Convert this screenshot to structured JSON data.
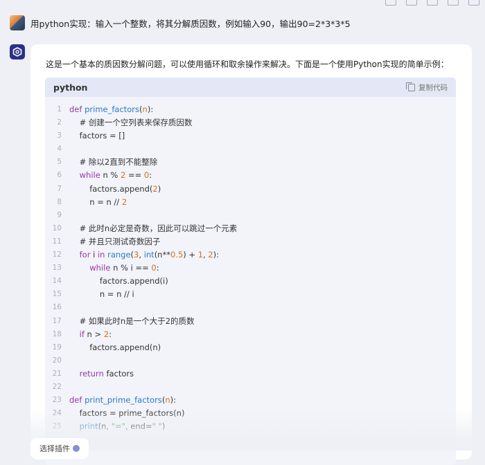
{
  "user": {
    "message": "用python实现：输入一个整数，将其分解质因数，例如输入90，输出90=2*3*3*5"
  },
  "answer": {
    "intro": "这是一个基本的质因数分解问题，可以使用循环和取余操作来解决。下面是一个使用Python实现的简单示例：",
    "code_block": {
      "language": "python",
      "copy_label": "复制代码",
      "lines": [
        [
          {
            "t": "def ",
            "c": "kw"
          },
          {
            "t": "prime_factors",
            "c": "fn"
          },
          {
            "t": "(",
            "c": ""
          },
          {
            "t": "n",
            "c": "num"
          },
          {
            "t": "):",
            "c": ""
          }
        ],
        [
          {
            "t": "    # 创建一个空列表来保存质因数",
            "c": "cm"
          }
        ],
        [
          {
            "t": "    factors = []",
            "c": ""
          }
        ],
        [],
        [
          {
            "t": "    # 除以2直到不能整除",
            "c": "cm"
          }
        ],
        [
          {
            "t": "    ",
            "c": ""
          },
          {
            "t": "while",
            "c": "kw"
          },
          {
            "t": " n % ",
            "c": ""
          },
          {
            "t": "2",
            "c": "num"
          },
          {
            "t": " == ",
            "c": ""
          },
          {
            "t": "0",
            "c": "num"
          },
          {
            "t": ":",
            "c": ""
          }
        ],
        [
          {
            "t": "        factors.append(",
            "c": ""
          },
          {
            "t": "2",
            "c": "num"
          },
          {
            "t": ")",
            "c": ""
          }
        ],
        [
          {
            "t": "        n = n // ",
            "c": ""
          },
          {
            "t": "2",
            "c": "num"
          }
        ],
        [],
        [
          {
            "t": "    # 此时n必定是奇数，因此可以跳过一个元素",
            "c": "cm"
          }
        ],
        [
          {
            "t": "    # 并且只测试奇数因子",
            "c": "cm"
          }
        ],
        [
          {
            "t": "    ",
            "c": ""
          },
          {
            "t": "for",
            "c": "kw"
          },
          {
            "t": " i ",
            "c": ""
          },
          {
            "t": "in",
            "c": "kw"
          },
          {
            "t": " ",
            "c": ""
          },
          {
            "t": "range",
            "c": "fn"
          },
          {
            "t": "(",
            "c": ""
          },
          {
            "t": "3",
            "c": "num"
          },
          {
            "t": ", ",
            "c": ""
          },
          {
            "t": "int",
            "c": "fn"
          },
          {
            "t": "(n**",
            "c": ""
          },
          {
            "t": "0.5",
            "c": "num"
          },
          {
            "t": ") + ",
            "c": ""
          },
          {
            "t": "1",
            "c": "num"
          },
          {
            "t": ", ",
            "c": ""
          },
          {
            "t": "2",
            "c": "num"
          },
          {
            "t": "):",
            "c": ""
          }
        ],
        [
          {
            "t": "        ",
            "c": ""
          },
          {
            "t": "while",
            "c": "kw"
          },
          {
            "t": " n % i == ",
            "c": ""
          },
          {
            "t": "0",
            "c": "num"
          },
          {
            "t": ":",
            "c": ""
          }
        ],
        [
          {
            "t": "            factors.append(i)",
            "c": ""
          }
        ],
        [
          {
            "t": "            n = n // i",
            "c": ""
          }
        ],
        [],
        [
          {
            "t": "    # 如果此时n是一个大于2的质数",
            "c": "cm"
          }
        ],
        [
          {
            "t": "    ",
            "c": ""
          },
          {
            "t": "if",
            "c": "kw"
          },
          {
            "t": " n > ",
            "c": ""
          },
          {
            "t": "2",
            "c": "num"
          },
          {
            "t": ":",
            "c": ""
          }
        ],
        [
          {
            "t": "        factors.append(n)",
            "c": ""
          }
        ],
        [],
        [
          {
            "t": "    ",
            "c": ""
          },
          {
            "t": "return",
            "c": "kw"
          },
          {
            "t": " factors",
            "c": ""
          }
        ],
        [],
        [
          {
            "t": "def ",
            "c": "kw"
          },
          {
            "t": "print_prime_factors",
            "c": "fn"
          },
          {
            "t": "(",
            "c": ""
          },
          {
            "t": "n",
            "c": "num"
          },
          {
            "t": "):",
            "c": ""
          }
        ],
        [
          {
            "t": "    factors = prime_factors(n)",
            "c": ""
          }
        ],
        [
          {
            "t": "    ",
            "c": ""
          },
          {
            "t": "print",
            "c": "fn"
          },
          {
            "t": "(n, ",
            "c": ""
          },
          {
            "t": "\"=\"",
            "c": "str"
          },
          {
            "t": ", end=",
            "c": ""
          },
          {
            "t": "\" \"",
            "c": "str"
          },
          {
            "t": ")",
            "c": ""
          }
        ]
      ]
    }
  },
  "footer": {
    "plugin_label": "选择插件"
  }
}
